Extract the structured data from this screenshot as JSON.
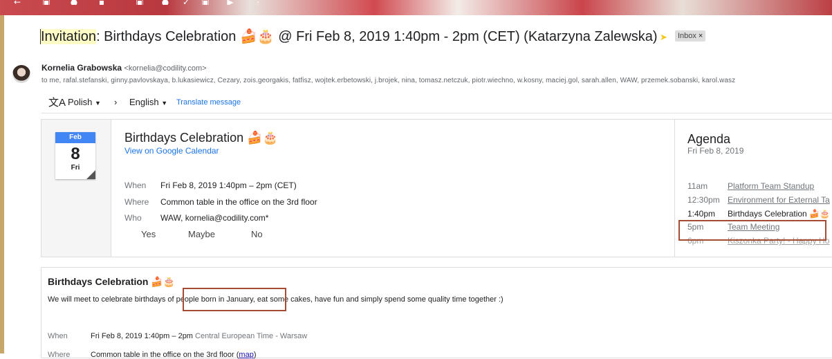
{
  "header": {
    "subject_highlight": "Invitation",
    "subject_rest": ": Birthdays Celebration 🍰🎂 @ Fri Feb 8, 2019 1:40pm - 2pm (CET) (Katarzyna Zalewska)",
    "label": "Inbox",
    "label_close": "×"
  },
  "sender": {
    "name": "Kornelia Grabowska",
    "email": "<kornelia@codility.com>",
    "recipients": "to me, rafal.stefanski, ginny.pavlovskaya, b.lukasiewicz, Cezary, zois.georgakis, fatfisz, wojtek.erbetowski, j.brojek, nina, tomasz.netczuk, piotr.wiechno, w.kosny, maciej.gol, sarah.allen, WAW, przemek.sobanski, karol.wasz"
  },
  "translate": {
    "from_language": "Polish",
    "to_language": "English",
    "link": "Translate message"
  },
  "invite": {
    "month": "Feb",
    "day": "8",
    "weekday": "Fri",
    "title": "Birthdays Celebration 🍰🎂",
    "view_link": "View on Google Calendar",
    "when_label": "When",
    "when_value": "Fri Feb 8, 2019 1:40pm – 2pm (CET)",
    "where_label": "Where",
    "where_value": "Common table in the office on the 3rd floor",
    "who_label": "Who",
    "who_value_bold": "WAW",
    "who_value_rest": ", kornelia@codility.com*",
    "rsvp_yes": "Yes",
    "rsvp_maybe": "Maybe",
    "rsvp_no": "No"
  },
  "agenda": {
    "title": "Agenda",
    "date": "Fri Feb 8, 2019",
    "items": [
      {
        "time": "11am",
        "event": "Platform Team Standup"
      },
      {
        "time": "12:30pm",
        "event": "Environment for External Ta"
      },
      {
        "time": "1:40pm",
        "event": "Birthdays Celebration 🍰🎂"
      },
      {
        "time": "5pm",
        "event": "Team Meeting"
      },
      {
        "time": "6pm",
        "event": "Kiszonka Party! - Happy Ho"
      }
    ]
  },
  "description": {
    "title": "Birthdays Celebration 🍰🎂",
    "text": "We will meet to celebrate birthdays of people born in January, eat some cakes, have fun and simply spend some quality time together :)",
    "when_label": "When",
    "when_value": "Fri Feb 8, 2019 1:40pm – 2pm",
    "when_tz": "Central European Time - Warsaw",
    "where_label": "Where",
    "where_value": "Common table in the office on the 3rd floor (",
    "map_link": "map",
    "where_close": ")"
  }
}
